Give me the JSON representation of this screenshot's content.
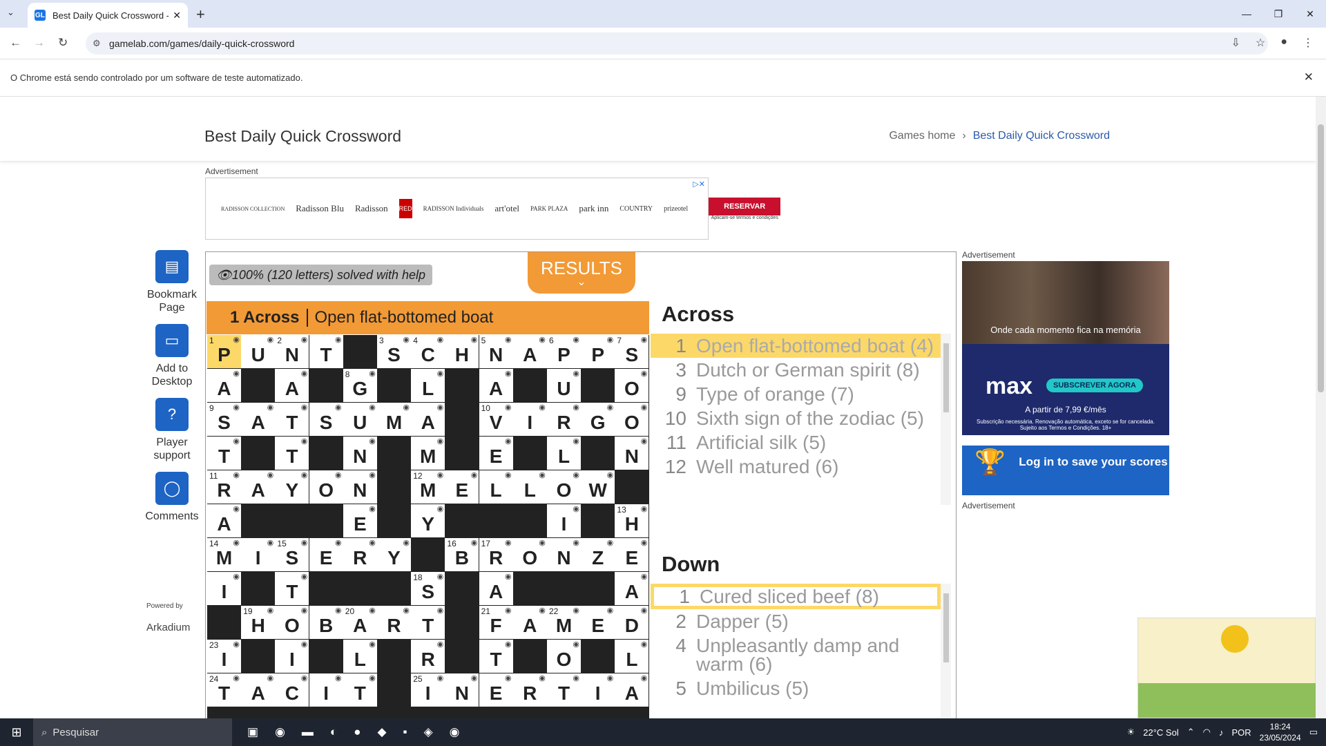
{
  "browser": {
    "tab_title": "Best Daily Quick Crossword - Fr",
    "tab_favicon": "GL",
    "url": "gamelab.com/games/daily-quick-crossword",
    "automation_notice": "O Chrome está sendo controlado por um software de teste automatizado."
  },
  "page": {
    "title": "Best Daily Quick Crossword",
    "breadcrumb": {
      "home": "Games home",
      "current": "Best Daily Quick Crossword"
    },
    "ad_label": "Advertisement",
    "top_ad": {
      "logos": [
        "RADISSON COLLECTION",
        "Radisson Blu",
        "Radisson",
        "RED",
        "RADISSON Individuals",
        "art'otel",
        "PARK PLAZA",
        "park inn",
        "COUNTRY",
        "prizeotel"
      ],
      "button": "RESERVAR",
      "fine": "Aplicam-se termos e condições"
    }
  },
  "sidebar": [
    {
      "icon": "bookmark-icon",
      "label": "Bookmark Page"
    },
    {
      "icon": "desktop-icon",
      "label": "Add to Desktop"
    },
    {
      "icon": "help-icon",
      "label": "Player support"
    },
    {
      "icon": "comments-icon",
      "label": "Comments"
    }
  ],
  "powered_by": "Powered by",
  "arkadium": "Arkadium",
  "game": {
    "help_badge": "100% (120 letters) solved with help",
    "results_button": "RESULTS",
    "current_clue": {
      "ref": "1 Across",
      "text": "Open flat-bottomed boat"
    },
    "grid": [
      "PUNT#SCHNAPPS",
      "A#A#G#L#A#U#O",
      "SATSUMA#VIRGO",
      "T#T#N#M#E#L#N",
      "RAYON#MELLOW#",
      "A###E#Y###I#H",
      "MISERY#BRONZE",
      "I#T###S#A###A",
      "#HOBART#FAMED",
      "I#I#L#R#T#O#L",
      "TACIT#INERTIA"
    ],
    "numbers": {
      "0,0": "1",
      "0,2": "2",
      "0,5": "3",
      "0,6": "4",
      "0,8": "5",
      "0,10": "6",
      "0,12": "7",
      "1,4": "8",
      "2,0": "9",
      "2,8": "10",
      "4,0": "11",
      "4,6": "12",
      "5,12": "13",
      "6,0": "14",
      "6,2": "15",
      "6,7": "16",
      "6,8": "17",
      "7,6": "18",
      "8,1": "19",
      "8,4": "20",
      "8,8": "21",
      "8,10": "22",
      "9,0": "23",
      "10,0": "24",
      "10,6": "25"
    },
    "highlight": [
      "0,0"
    ],
    "across_title": "Across",
    "across": [
      {
        "n": "1",
        "text": "Open flat-bottomed boat (4)",
        "state": "active"
      },
      {
        "n": "3",
        "text": "Dutch or German spirit (8)"
      },
      {
        "n": "9",
        "text": "Type of orange (7)"
      },
      {
        "n": "10",
        "text": "Sixth sign of the zodiac (5)"
      },
      {
        "n": "11",
        "text": "Artificial silk (5)"
      },
      {
        "n": "12",
        "text": "Well matured (6)"
      }
    ],
    "down_title": "Down",
    "down": [
      {
        "n": "1",
        "text": "Cured sliced beef (8)",
        "state": "outlined"
      },
      {
        "n": "2",
        "text": "Dapper (5)"
      },
      {
        "n": "4",
        "text": "Unpleasantly damp and warm (6)"
      },
      {
        "n": "5",
        "text": "Umbilicus (5)"
      }
    ]
  },
  "right_ad": {
    "tagline": "Onde cada momento fica na memória",
    "brand": "max",
    "cta": "SUBSCREVER AGORA",
    "price": "A partir de 7,99 €/mês",
    "fine": "Subscrição necessária. Renovação automática, exceto se for cancelada. Sujeito aos Termos e Condições. 18+"
  },
  "login_cta": "Log in to save your scores",
  "taskbar": {
    "search": "Pesquisar",
    "weather": "22°C Sol",
    "lang": "POR",
    "time": "18:24",
    "date": "23/05/2024"
  }
}
